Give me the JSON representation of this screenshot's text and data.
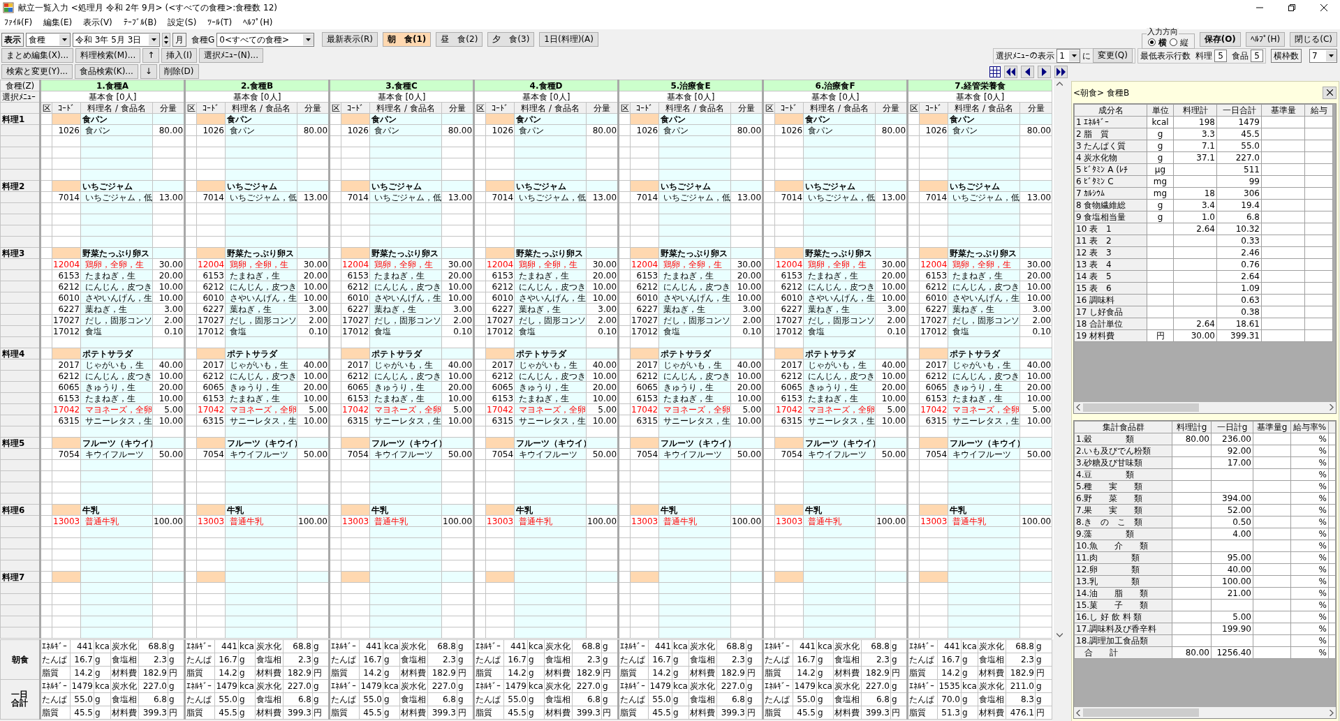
{
  "window": {
    "title": "献立一覧入力 <処理月 令和 2年 9月> (<すべての食種>:食種数 12)"
  },
  "menu": [
    "ﾌｧｲﾙ(F)",
    "編集(E)",
    "表示(V)",
    "ﾃｰﾌﾞﾙ(B)",
    "設定(S)",
    "ﾂｰﾙ(T)",
    "ﾍﾙﾌﾟ(H)"
  ],
  "toolbar": {
    "view_label": "表示",
    "view_select": "食種",
    "date_select": "令和 3年 5月 3日",
    "month_button": "月",
    "group_label": "食種G",
    "group_select": "0<すべての食種>",
    "refresh_button": "最新表示(R)",
    "meals": [
      {
        "label": "朝　食(1)",
        "selected": true
      },
      {
        "label": "昼　食(2)",
        "selected": false
      },
      {
        "label": "夕　食(3)",
        "selected": false
      },
      {
        "label": "1日(料理)(A)",
        "selected": false
      }
    ],
    "direction": {
      "label": "入力方向",
      "options": [
        {
          "label": "横",
          "selected": true
        },
        {
          "label": "縦",
          "selected": false
        }
      ]
    },
    "window_buttons": [
      "保存(O)",
      "ﾍﾙﾌﾟ(H)",
      "閉じる(C)"
    ],
    "row2_buttons": [
      "まとめ編集(X)...",
      "料理検索(M)...",
      "↑",
      "挿入(I)",
      "選択ﾒﾆｭｰ(N)..."
    ],
    "row3_buttons": [
      "検索と変更(Y)...",
      "食品検索(K)...",
      "↓",
      "削除(D)"
    ],
    "menu_display": {
      "label": "選択ﾒﾆｭｰの表示",
      "value": "1",
      "suffix": "に",
      "button": "変更(Q)"
    },
    "min_rows": {
      "label": "最低表示行数",
      "dish_label": "料理",
      "dish_value": "5",
      "food_label": "食品",
      "food_value": "5"
    },
    "frame_count": {
      "label": "横枠数",
      "value": "7"
    }
  },
  "grid": {
    "corner": "食種(Z)",
    "menu_label": "選択ﾒﾆｭｰ",
    "dish_labels": [
      "料理1",
      "料理2",
      "料理3",
      "料理4",
      "料理5",
      "料理6",
      "料理7"
    ],
    "summary_labels": [
      "朝食",
      "一日合計"
    ],
    "columns": [
      {
        "title": "1.食種A",
        "menu": "基本食 [0人]",
        "headers": [
          "区",
          "ｺｰﾄﾞ",
          "料理名 / 食品名",
          "分量"
        ],
        "dishes": [
          {
            "name": "食パン",
            "foods": [
              {
                "code": "1026",
                "name": "食パン",
                "amount": "80.00",
                "highlighted": false
              }
            ]
          },
          {
            "name": "いちごジャム",
            "foods": [
              {
                "code": "7014",
                "name": "いちごジャム，低",
                "amount": "13.00",
                "highlighted": false
              }
            ]
          },
          {
            "name": "野菜たっぷり卵ス",
            "foods": [
              {
                "code": "12004",
                "name": "鶏卵，全卵，生",
                "amount": "30.00",
                "highlighted": true
              },
              {
                "code": "6153",
                "name": "たまねぎ，生",
                "amount": "20.00",
                "highlighted": false
              },
              {
                "code": "6212",
                "name": "にんじん，皮つき",
                "amount": "10.00",
                "highlighted": false
              },
              {
                "code": "6010",
                "name": "さやいんげん，生",
                "amount": "10.00",
                "highlighted": false
              },
              {
                "code": "6227",
                "name": "葉ねぎ，生",
                "amount": "3.00",
                "highlighted": false
              },
              {
                "code": "17027",
                "name": "だし，固形コンソ",
                "amount": "2.00",
                "highlighted": false
              },
              {
                "code": "17012",
                "name": "食塩",
                "amount": "0.10",
                "highlighted": false
              }
            ]
          },
          {
            "name": "ポテトサラダ",
            "foods": [
              {
                "code": "2017",
                "name": "じゃがいも，生",
                "amount": "40.00",
                "highlighted": false
              },
              {
                "code": "6212",
                "name": "にんじん，皮つき",
                "amount": "10.00",
                "highlighted": false
              },
              {
                "code": "6065",
                "name": "きゅうり，生",
                "amount": "20.00",
                "highlighted": false
              },
              {
                "code": "6153",
                "name": "たまねぎ，生",
                "amount": "10.00",
                "highlighted": false
              },
              {
                "code": "17042",
                "name": "マヨネーズ，全卵",
                "amount": "5.00",
                "highlighted": true
              },
              {
                "code": "6315",
                "name": "サニーレタス，生",
                "amount": "10.00",
                "highlighted": false
              }
            ]
          },
          {
            "name": "フルーツ（キウイ）",
            "foods": [
              {
                "code": "7054",
                "name": "キウイフルーツ",
                "amount": "50.00",
                "highlighted": false
              }
            ]
          },
          {
            "name": "牛乳",
            "foods": [
              {
                "code": "13003",
                "name": "普通牛乳",
                "amount": "100.00",
                "highlighted": true
              }
            ]
          }
        ],
        "breakfast": [
          [
            "ｴﾈﾙｷﾞｰ",
            "441",
            "kca",
            "炭水化",
            "68.8",
            "g"
          ],
          [
            "たんぱ",
            "16.7",
            "g",
            "食塩相",
            "2.3",
            "g"
          ],
          [
            "脂質",
            "14.2",
            "g",
            "材料費",
            "182.9",
            "円"
          ]
        ],
        "daily": [
          [
            "ｴﾈﾙｷﾞｰ",
            "1479",
            "kca",
            "炭水化",
            "227.0",
            "g"
          ],
          [
            "たんぱ",
            "55.0",
            "g",
            "食塩相",
            "6.8",
            "g"
          ],
          [
            "脂質",
            "45.5",
            "g",
            "材料費",
            "399.3",
            "円"
          ]
        ]
      },
      {
        "title": "2.食種B",
        "menu": "基本食 [0人]",
        "headers": [
          "区",
          "ｺｰﾄﾞ",
          "料理名 / 食品名",
          "分量"
        ],
        "dishes": [
          {
            "name": "食パン",
            "foods": [
              {
                "code": "1026",
                "name": "食パン",
                "amount": "80.00",
                "highlighted": false
              }
            ]
          },
          {
            "name": "いちごジャム",
            "foods": [
              {
                "code": "7014",
                "name": "いちごジャム，低",
                "amount": "13.00",
                "highlighted": false
              }
            ]
          },
          {
            "name": "野菜たっぷり卵ス",
            "foods": [
              {
                "code": "12004",
                "name": "鶏卵，全卵，生",
                "amount": "30.00",
                "highlighted": true
              },
              {
                "code": "6153",
                "name": "たまねぎ，生",
                "amount": "20.00",
                "highlighted": false
              },
              {
                "code": "6212",
                "name": "にんじん，皮つき",
                "amount": "10.00",
                "highlighted": false
              },
              {
                "code": "6010",
                "name": "さやいんげん，生",
                "amount": "10.00",
                "highlighted": false
              },
              {
                "code": "6227",
                "name": "葉ねぎ，生",
                "amount": "3.00",
                "highlighted": false
              },
              {
                "code": "17027",
                "name": "だし，固形コンソ",
                "amount": "2.00",
                "highlighted": false
              },
              {
                "code": "17012",
                "name": "食塩",
                "amount": "0.10",
                "highlighted": false
              }
            ]
          },
          {
            "name": "ポテトサラダ",
            "foods": [
              {
                "code": "2017",
                "name": "じゃがいも，生",
                "amount": "40.00",
                "highlighted": false
              },
              {
                "code": "6212",
                "name": "にんじん，皮つき",
                "amount": "10.00",
                "highlighted": false
              },
              {
                "code": "6065",
                "name": "きゅうり，生",
                "amount": "20.00",
                "highlighted": false
              },
              {
                "code": "6153",
                "name": "たまねぎ，生",
                "amount": "10.00",
                "highlighted": false
              },
              {
                "code": "17042",
                "name": "マヨネーズ，全卵",
                "amount": "5.00",
                "highlighted": true
              },
              {
                "code": "6315",
                "name": "サニーレタス，生",
                "amount": "10.00",
                "highlighted": false
              }
            ]
          },
          {
            "name": "フルーツ（キウイ）",
            "foods": [
              {
                "code": "7054",
                "name": "キウイフルーツ",
                "amount": "50.00",
                "highlighted": false
              }
            ]
          },
          {
            "name": "牛乳",
            "foods": [
              {
                "code": "13003",
                "name": "普通牛乳",
                "amount": "100.00",
                "highlighted": true
              }
            ]
          }
        ],
        "breakfast": [
          [
            "ｴﾈﾙｷﾞｰ",
            "441",
            "kca",
            "炭水化",
            "68.8",
            "g"
          ],
          [
            "たんぱ",
            "16.7",
            "g",
            "食塩相",
            "2.3",
            "g"
          ],
          [
            "脂質",
            "14.2",
            "g",
            "材料費",
            "182.9",
            "円"
          ]
        ],
        "daily": [
          [
            "ｴﾈﾙｷﾞｰ",
            "1479",
            "kca",
            "炭水化",
            "227.0",
            "g"
          ],
          [
            "たんぱ",
            "55.0",
            "g",
            "食塩相",
            "6.8",
            "g"
          ],
          [
            "脂質",
            "45.5",
            "g",
            "材料費",
            "399.3",
            "円"
          ]
        ]
      },
      {
        "title": "3.食種C",
        "menu": "基本食 [0人]",
        "headers": [
          "区",
          "ｺｰﾄﾞ",
          "料理名 / 食品名",
          "分量"
        ],
        "dishes": [
          {
            "name": "食パン",
            "foods": [
              {
                "code": "1026",
                "name": "食パン",
                "amount": "80.00",
                "highlighted": false
              }
            ]
          },
          {
            "name": "いちごジャム",
            "foods": [
              {
                "code": "7014",
                "name": "いちごジャム，低",
                "amount": "13.00",
                "highlighted": false
              }
            ]
          },
          {
            "name": "野菜たっぷり卵ス",
            "foods": [
              {
                "code": "12004",
                "name": "鶏卵，全卵，生",
                "amount": "30.00",
                "highlighted": true
              },
              {
                "code": "6153",
                "name": "たまねぎ，生",
                "amount": "20.00",
                "highlighted": false
              },
              {
                "code": "6212",
                "name": "にんじん，皮つき",
                "amount": "10.00",
                "highlighted": false
              },
              {
                "code": "6010",
                "name": "さやいんげん，生",
                "amount": "10.00",
                "highlighted": false
              },
              {
                "code": "6227",
                "name": "葉ねぎ，生",
                "amount": "3.00",
                "highlighted": false
              },
              {
                "code": "17027",
                "name": "だし，固形コンソ",
                "amount": "2.00",
                "highlighted": false
              },
              {
                "code": "17012",
                "name": "食塩",
                "amount": "0.10",
                "highlighted": false
              }
            ]
          },
          {
            "name": "ポテトサラダ",
            "foods": [
              {
                "code": "2017",
                "name": "じゃがいも，生",
                "amount": "40.00",
                "highlighted": false
              },
              {
                "code": "6212",
                "name": "にんじん，皮つき",
                "amount": "10.00",
                "highlighted": false
              },
              {
                "code": "6065",
                "name": "きゅうり，生",
                "amount": "20.00",
                "highlighted": false
              },
              {
                "code": "6153",
                "name": "たまねぎ，生",
                "amount": "10.00",
                "highlighted": false
              },
              {
                "code": "17042",
                "name": "マヨネーズ，全卵",
                "amount": "5.00",
                "highlighted": true
              },
              {
                "code": "6315",
                "name": "サニーレタス，生",
                "amount": "10.00",
                "highlighted": false
              }
            ]
          },
          {
            "name": "フルーツ（キウイ）",
            "foods": [
              {
                "code": "7054",
                "name": "キウイフルーツ",
                "amount": "50.00",
                "highlighted": false
              }
            ]
          },
          {
            "name": "牛乳",
            "foods": [
              {
                "code": "13003",
                "name": "普通牛乳",
                "amount": "100.00",
                "highlighted": true
              }
            ]
          }
        ],
        "breakfast": [
          [
            "ｴﾈﾙｷﾞｰ",
            "441",
            "kca",
            "炭水化",
            "68.8",
            "g"
          ],
          [
            "たんぱ",
            "16.7",
            "g",
            "食塩相",
            "2.3",
            "g"
          ],
          [
            "脂質",
            "14.2",
            "g",
            "材料費",
            "182.9",
            "円"
          ]
        ],
        "daily": [
          [
            "ｴﾈﾙｷﾞｰ",
            "1479",
            "kca",
            "炭水化",
            "227.0",
            "g"
          ],
          [
            "たんぱ",
            "55.0",
            "g",
            "食塩相",
            "6.8",
            "g"
          ],
          [
            "脂質",
            "45.5",
            "g",
            "材料費",
            "399.3",
            "円"
          ]
        ]
      },
      {
        "title": "4.食種D",
        "menu": "基本食 [0人]",
        "headers": [
          "区",
          "ｺｰﾄﾞ",
          "料理名 / 食品名",
          "分量"
        ],
        "dishes": [
          {
            "name": "食パン",
            "foods": [
              {
                "code": "1026",
                "name": "食パン",
                "amount": "80.00",
                "highlighted": false
              }
            ]
          },
          {
            "name": "いちごジャム",
            "foods": [
              {
                "code": "7014",
                "name": "いちごジャム，低",
                "amount": "13.00",
                "highlighted": false
              }
            ]
          },
          {
            "name": "野菜たっぷり卵ス",
            "foods": [
              {
                "code": "12004",
                "name": "鶏卵，全卵，生",
                "amount": "30.00",
                "highlighted": true
              },
              {
                "code": "6153",
                "name": "たまねぎ，生",
                "amount": "20.00",
                "highlighted": false
              },
              {
                "code": "6212",
                "name": "にんじん，皮つき",
                "amount": "10.00",
                "highlighted": false
              },
              {
                "code": "6010",
                "name": "さやいんげん，生",
                "amount": "10.00",
                "highlighted": false
              },
              {
                "code": "6227",
                "name": "葉ねぎ，生",
                "amount": "3.00",
                "highlighted": false
              },
              {
                "code": "17027",
                "name": "だし，固形コンソ",
                "amount": "2.00",
                "highlighted": false
              },
              {
                "code": "17012",
                "name": "食塩",
                "amount": "0.10",
                "highlighted": false
              }
            ]
          },
          {
            "name": "ポテトサラダ",
            "foods": [
              {
                "code": "2017",
                "name": "じゃがいも，生",
                "amount": "40.00",
                "highlighted": false
              },
              {
                "code": "6212",
                "name": "にんじん，皮つき",
                "amount": "10.00",
                "highlighted": false
              },
              {
                "code": "6065",
                "name": "きゅうり，生",
                "amount": "20.00",
                "highlighted": false
              },
              {
                "code": "6153",
                "name": "たまねぎ，生",
                "amount": "10.00",
                "highlighted": false
              },
              {
                "code": "17042",
                "name": "マヨネーズ，全卵",
                "amount": "5.00",
                "highlighted": true
              },
              {
                "code": "6315",
                "name": "サニーレタス，生",
                "amount": "10.00",
                "highlighted": false
              }
            ]
          },
          {
            "name": "フルーツ（キウイ）",
            "foods": [
              {
                "code": "7054",
                "name": "キウイフルーツ",
                "amount": "50.00",
                "highlighted": false
              }
            ]
          },
          {
            "name": "牛乳",
            "foods": [
              {
                "code": "13003",
                "name": "普通牛乳",
                "amount": "100.00",
                "highlighted": true
              }
            ]
          }
        ],
        "breakfast": [
          [
            "ｴﾈﾙｷﾞｰ",
            "441",
            "kca",
            "炭水化",
            "68.8",
            "g"
          ],
          [
            "たんぱ",
            "16.7",
            "g",
            "食塩相",
            "2.3",
            "g"
          ],
          [
            "脂質",
            "14.2",
            "g",
            "材料費",
            "182.9",
            "円"
          ]
        ],
        "daily": [
          [
            "ｴﾈﾙｷﾞｰ",
            "1479",
            "kca",
            "炭水化",
            "227.0",
            "g"
          ],
          [
            "たんぱ",
            "55.0",
            "g",
            "食塩相",
            "6.8",
            "g"
          ],
          [
            "脂質",
            "45.5",
            "g",
            "材料費",
            "399.3",
            "円"
          ]
        ]
      },
      {
        "title": "5.治療食E",
        "menu": "基本食 [0人]",
        "headers": [
          "区",
          "ｺｰﾄﾞ",
          "料理名 / 食品名",
          "分量"
        ],
        "dishes": [
          {
            "name": "食パン",
            "foods": [
              {
                "code": "1026",
                "name": "食パン",
                "amount": "80.00",
                "highlighted": false
              }
            ]
          },
          {
            "name": "いちごジャム",
            "foods": [
              {
                "code": "7014",
                "name": "いちごジャム，低",
                "amount": "13.00",
                "highlighted": false
              }
            ]
          },
          {
            "name": "野菜たっぷり卵ス",
            "foods": [
              {
                "code": "12004",
                "name": "鶏卵，全卵，生",
                "amount": "30.00",
                "highlighted": true
              },
              {
                "code": "6153",
                "name": "たまねぎ，生",
                "amount": "20.00",
                "highlighted": false
              },
              {
                "code": "6212",
                "name": "にんじん，皮つき",
                "amount": "10.00",
                "highlighted": false
              },
              {
                "code": "6010",
                "name": "さやいんげん，生",
                "amount": "10.00",
                "highlighted": false
              },
              {
                "code": "6227",
                "name": "葉ねぎ，生",
                "amount": "3.00",
                "highlighted": false
              },
              {
                "code": "17027",
                "name": "だし，固形コンソ",
                "amount": "2.00",
                "highlighted": false
              },
              {
                "code": "17012",
                "name": "食塩",
                "amount": "0.10",
                "highlighted": false
              }
            ]
          },
          {
            "name": "ポテトサラダ",
            "foods": [
              {
                "code": "2017",
                "name": "じゃがいも，生",
                "amount": "40.00",
                "highlighted": false
              },
              {
                "code": "6212",
                "name": "にんじん，皮つき",
                "amount": "10.00",
                "highlighted": false
              },
              {
                "code": "6065",
                "name": "きゅうり，生",
                "amount": "20.00",
                "highlighted": false
              },
              {
                "code": "6153",
                "name": "たまねぎ，生",
                "amount": "10.00",
                "highlighted": false
              },
              {
                "code": "17042",
                "name": "マヨネーズ，全卵",
                "amount": "5.00",
                "highlighted": true
              },
              {
                "code": "6315",
                "name": "サニーレタス，生",
                "amount": "10.00",
                "highlighted": false
              }
            ]
          },
          {
            "name": "フルーツ（キウイ）",
            "foods": [
              {
                "code": "7054",
                "name": "キウイフルーツ",
                "amount": "50.00",
                "highlighted": false
              }
            ]
          },
          {
            "name": "牛乳",
            "foods": [
              {
                "code": "13003",
                "name": "普通牛乳",
                "amount": "100.00",
                "highlighted": true
              }
            ]
          }
        ],
        "breakfast": [
          [
            "ｴﾈﾙｷﾞｰ",
            "441",
            "kca",
            "炭水化",
            "68.8",
            "g"
          ],
          [
            "たんぱ",
            "16.7",
            "g",
            "食塩相",
            "2.3",
            "g"
          ],
          [
            "脂質",
            "14.2",
            "g",
            "材料費",
            "182.9",
            "円"
          ]
        ],
        "daily": [
          [
            "ｴﾈﾙｷﾞｰ",
            "1479",
            "kca",
            "炭水化",
            "227.0",
            "g"
          ],
          [
            "たんぱ",
            "55.0",
            "g",
            "食塩相",
            "6.8",
            "g"
          ],
          [
            "脂質",
            "45.5",
            "g",
            "材料費",
            "399.3",
            "円"
          ]
        ]
      },
      {
        "title": "6.治療食F",
        "menu": "基本食 [0人]",
        "headers": [
          "区",
          "ｺｰﾄﾞ",
          "料理名 / 食品名",
          "分量"
        ],
        "dishes": [
          {
            "name": "食パン",
            "foods": [
              {
                "code": "1026",
                "name": "食パン",
                "amount": "80.00",
                "highlighted": false
              }
            ]
          },
          {
            "name": "いちごジャム",
            "foods": [
              {
                "code": "7014",
                "name": "いちごジャム，低",
                "amount": "13.00",
                "highlighted": false
              }
            ]
          },
          {
            "name": "野菜たっぷり卵ス",
            "foods": [
              {
                "code": "12004",
                "name": "鶏卵，全卵，生",
                "amount": "30.00",
                "highlighted": true
              },
              {
                "code": "6153",
                "name": "たまねぎ，生",
                "amount": "20.00",
                "highlighted": false
              },
              {
                "code": "6212",
                "name": "にんじん，皮つき",
                "amount": "10.00",
                "highlighted": false
              },
              {
                "code": "6010",
                "name": "さやいんげん，生",
                "amount": "10.00",
                "highlighted": false
              },
              {
                "code": "6227",
                "name": "葉ねぎ，生",
                "amount": "3.00",
                "highlighted": false
              },
              {
                "code": "17027",
                "name": "だし，固形コンソ",
                "amount": "2.00",
                "highlighted": false
              },
              {
                "code": "17012",
                "name": "食塩",
                "amount": "0.10",
                "highlighted": false
              }
            ]
          },
          {
            "name": "ポテトサラダ",
            "foods": [
              {
                "code": "2017",
                "name": "じゃがいも，生",
                "amount": "40.00",
                "highlighted": false
              },
              {
                "code": "6212",
                "name": "にんじん，皮つき",
                "amount": "10.00",
                "highlighted": false
              },
              {
                "code": "6065",
                "name": "きゅうり，生",
                "amount": "20.00",
                "highlighted": false
              },
              {
                "code": "6153",
                "name": "たまねぎ，生",
                "amount": "10.00",
                "highlighted": false
              },
              {
                "code": "17042",
                "name": "マヨネーズ，全卵",
                "amount": "5.00",
                "highlighted": true
              },
              {
                "code": "6315",
                "name": "サニーレタス，生",
                "amount": "10.00",
                "highlighted": false
              }
            ]
          },
          {
            "name": "フルーツ（キウイ）",
            "foods": [
              {
                "code": "7054",
                "name": "キウイフルーツ",
                "amount": "50.00",
                "highlighted": false
              }
            ]
          },
          {
            "name": "牛乳",
            "foods": [
              {
                "code": "13003",
                "name": "普通牛乳",
                "amount": "100.00",
                "highlighted": true
              }
            ]
          }
        ],
        "breakfast": [
          [
            "ｴﾈﾙｷﾞｰ",
            "441",
            "kca",
            "炭水化",
            "68.8",
            "g"
          ],
          [
            "たんぱ",
            "16.7",
            "g",
            "食塩相",
            "2.3",
            "g"
          ],
          [
            "脂質",
            "14.2",
            "g",
            "材料費",
            "182.9",
            "円"
          ]
        ],
        "daily": [
          [
            "ｴﾈﾙｷﾞｰ",
            "1479",
            "kca",
            "炭水化",
            "227.0",
            "g"
          ],
          [
            "たんぱ",
            "55.0",
            "g",
            "食塩相",
            "6.8",
            "g"
          ],
          [
            "脂質",
            "45.5",
            "g",
            "材料費",
            "399.3",
            "円"
          ]
        ]
      },
      {
        "title": "7.経管栄養食",
        "menu": "基本食 [0人]",
        "headers": [
          "区",
          "ｺｰﾄﾞ",
          "料理名 / 食品名",
          "分量"
        ],
        "dishes": [
          {
            "name": "食パン",
            "foods": [
              {
                "code": "1026",
                "name": "食パン",
                "amount": "80.00",
                "highlighted": false
              }
            ]
          },
          {
            "name": "いちごジャム",
            "foods": [
              {
                "code": "7014",
                "name": "いちごジャム，低",
                "amount": "13.00",
                "highlighted": false
              }
            ]
          },
          {
            "name": "野菜たっぷり卵ス",
            "foods": [
              {
                "code": "12004",
                "name": "鶏卵，全卵，生",
                "amount": "30.00",
                "highlighted": true
              },
              {
                "code": "6153",
                "name": "たまねぎ，生",
                "amount": "20.00",
                "highlighted": false
              },
              {
                "code": "6212",
                "name": "にんじん，皮つき",
                "amount": "10.00",
                "highlighted": false
              },
              {
                "code": "6010",
                "name": "さやいんげん，生",
                "amount": "10.00",
                "highlighted": false
              },
              {
                "code": "6227",
                "name": "葉ねぎ，生",
                "amount": "3.00",
                "highlighted": false
              },
              {
                "code": "17027",
                "name": "だし，固形コンソ",
                "amount": "2.00",
                "highlighted": false
              },
              {
                "code": "17012",
                "name": "食塩",
                "amount": "0.10",
                "highlighted": false
              }
            ]
          },
          {
            "name": "ポテトサラダ",
            "foods": [
              {
                "code": "2017",
                "name": "じゃがいも，生",
                "amount": "40.00",
                "highlighted": false
              },
              {
                "code": "6212",
                "name": "にんじん，皮つき",
                "amount": "10.00",
                "highlighted": false
              },
              {
                "code": "6065",
                "name": "きゅうり，生",
                "amount": "20.00",
                "highlighted": false
              },
              {
                "code": "6153",
                "name": "たまねぎ，生",
                "amount": "10.00",
                "highlighted": false
              },
              {
                "code": "17042",
                "name": "マヨネーズ，全卵",
                "amount": "5.00",
                "highlighted": true
              },
              {
                "code": "6315",
                "name": "サニーレタス，生",
                "amount": "10.00",
                "highlighted": false
              }
            ]
          },
          {
            "name": "フルーツ（キウイ）",
            "foods": [
              {
                "code": "7054",
                "name": "キウイフルーツ",
                "amount": "50.00",
                "highlighted": false
              }
            ]
          },
          {
            "name": "牛乳",
            "foods": [
              {
                "code": "13003",
                "name": "普通牛乳",
                "amount": "100.00",
                "highlighted": true
              }
            ]
          }
        ],
        "breakfast": [
          [
            "ｴﾈﾙｷﾞｰ",
            "441",
            "kca",
            "炭水化",
            "68.8",
            "g"
          ],
          [
            "たんぱ",
            "16.7",
            "g",
            "食塩相",
            "2.3",
            "g"
          ],
          [
            "脂質",
            "14.2",
            "g",
            "材料費",
            "182.9",
            "円"
          ]
        ],
        "daily": [
          [
            "ｴﾈﾙｷﾞｰ",
            "1535",
            "kca",
            "炭水化",
            "211.0",
            "g"
          ],
          [
            "たんぱ",
            "70.0",
            "g",
            "食塩相",
            "8.3",
            "g"
          ],
          [
            "脂質",
            "51.3",
            "g",
            "材料費",
            "476.1",
            "円"
          ]
        ]
      }
    ]
  },
  "detail": {
    "title": "<朝食> 食種B",
    "nutrients": {
      "columns": [
        "成分名",
        "単位",
        "料理計",
        "一日合計",
        "基準量",
        "給与"
      ],
      "rows": [
        {
          "name": "1 ｴﾈﾙｷﾞｰ",
          "unit": "kcal",
          "dish": "198",
          "day": "1479"
        },
        {
          "name": "2 脂　質",
          "unit": "g",
          "dish": "3.3",
          "day": "45.5"
        },
        {
          "name": "3 たんぱく質",
          "unit": "g",
          "dish": "7.1",
          "day": "55.0"
        },
        {
          "name": "4 炭水化物",
          "unit": "g",
          "dish": "37.1",
          "day": "227.0"
        },
        {
          "name": "5 ﾋﾞﾀﾐﾝ A (ﾚﾁ",
          "unit": "μg",
          "day": "511"
        },
        {
          "name": "6 ﾋﾞﾀﾐﾝ C",
          "unit": "mg",
          "day": "99"
        },
        {
          "name": "7 ｶﾙｼｳﾑ",
          "unit": "mg",
          "dish": "18",
          "day": "306"
        },
        {
          "name": "8 食物繊維総",
          "unit": "g",
          "dish": "3.4",
          "day": "19.4"
        },
        {
          "name": "9 食塩相当量",
          "unit": "g",
          "dish": "1.0",
          "day": "6.8"
        },
        {
          "name": "10 表　1",
          "dish": "2.64",
          "day": "10.32"
        },
        {
          "name": "11 表　2",
          "day": "0.33"
        },
        {
          "name": "12 表　3",
          "day": "2.46"
        },
        {
          "name": "13 表　4",
          "day": "0.76"
        },
        {
          "name": "14 表　5",
          "day": "2.64"
        },
        {
          "name": "15 表　6",
          "day": "1.09"
        },
        {
          "name": "16 調味料",
          "day": "0.63"
        },
        {
          "name": "17 し好食品",
          "day": "0.38"
        },
        {
          "name": "18 合計単位",
          "dish": "2.64",
          "day": "18.61"
        },
        {
          "name": "19 材料費",
          "unit": "円",
          "dish": "30.00",
          "day": "399.31"
        }
      ]
    },
    "food_groups": {
      "columns": [
        "集計食品群",
        "料理計g",
        "一日計g",
        "基準量g",
        "給与率%"
      ],
      "rows": [
        {
          "name": "1.穀　　　　類",
          "dish": "80.00",
          "day": "236.00",
          "rate": "%"
        },
        {
          "name": "2.いも及びでん粉類",
          "day": "92.00",
          "rate": "%"
        },
        {
          "name": "3.砂糖及び甘味類",
          "day": "17.00",
          "rate": "%"
        },
        {
          "name": "4.豆　　　　類",
          "rate": "%"
        },
        {
          "name": "5.種　　実　　類",
          "rate": "%"
        },
        {
          "name": "6.野　　菜　　類",
          "day": "394.00",
          "rate": "%"
        },
        {
          "name": "7.果　　実　　類",
          "day": "52.00",
          "rate": "%"
        },
        {
          "name": "8.き　の　こ　類",
          "day": "0.50",
          "rate": "%"
        },
        {
          "name": "9.藻　　　　類",
          "day": "4.00",
          "rate": "%"
        },
        {
          "name": "10.魚　　介　　類",
          "rate": "%"
        },
        {
          "name": "11.肉　　　　類",
          "day": "95.00",
          "rate": "%"
        },
        {
          "name": "12.卵　　　　類",
          "day": "40.00",
          "rate": "%"
        },
        {
          "name": "13.乳　　　　類",
          "day": "100.00",
          "rate": "%"
        },
        {
          "name": "14.油　　脂　　類",
          "day": "21.00",
          "rate": "%"
        },
        {
          "name": "15.菓　　子　　類",
          "rate": "%"
        },
        {
          "name": "16.し 好 飲 料 類",
          "day": "5.00",
          "rate": "%"
        },
        {
          "name": "17.調味料及び香辛料",
          "day": "199.90",
          "rate": "%"
        },
        {
          "name": "18.調理加工食品類",
          "rate": "%"
        },
        {
          "name": "　合　　計",
          "dish": "80.00",
          "day": "1256.40",
          "rate": "%"
        }
      ]
    }
  }
}
